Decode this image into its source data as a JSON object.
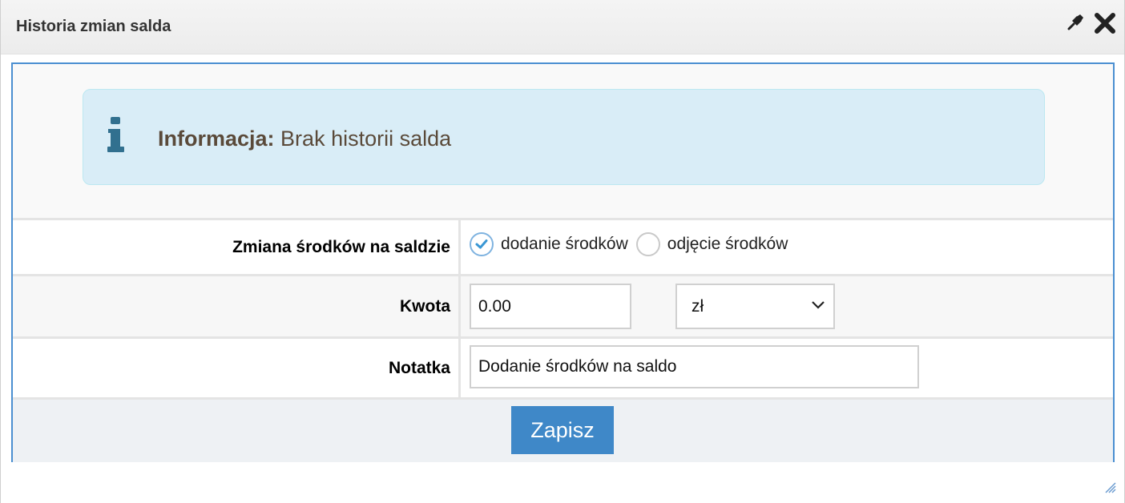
{
  "dialog": {
    "title": "Historia zmian salda",
    "pin_icon": "pin-icon",
    "close_icon": "close-icon"
  },
  "alert": {
    "icon": "info-icon",
    "label": "Informacja:",
    "message": " Brak historii salda"
  },
  "form": {
    "balance_change": {
      "label": "Zmiana środków na saldzie",
      "options": [
        {
          "label": "dodanie środków",
          "checked": true
        },
        {
          "label": "odjęcie środków",
          "checked": false
        }
      ]
    },
    "amount": {
      "label": "Kwota",
      "value": "0.00",
      "currency": "zł"
    },
    "note": {
      "label": "Notatka",
      "value": "Dodanie środków na saldo"
    },
    "save_label": "Zapisz"
  },
  "colors": {
    "accent": "#3f88c8",
    "alert_bg": "#d9edf7",
    "border": "#4b8fd1"
  }
}
